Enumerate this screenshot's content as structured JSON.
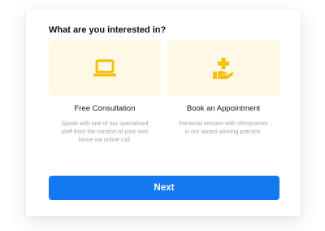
{
  "question": "What are you interested in?",
  "accent_color": "#f4c20d",
  "tile_background": "#fef8e4",
  "button_color": "#1479f0",
  "options": [
    {
      "icon": "laptop-icon",
      "title": "Free Consultation",
      "description": "Speak with one of our specialised staff from the comfort of your own home via online call."
    },
    {
      "icon": "hand-with-plus-icon",
      "title": "Book an Appointment",
      "description": "Personal session with chiropractor in our award winning practice."
    }
  ],
  "next_label": "Next"
}
